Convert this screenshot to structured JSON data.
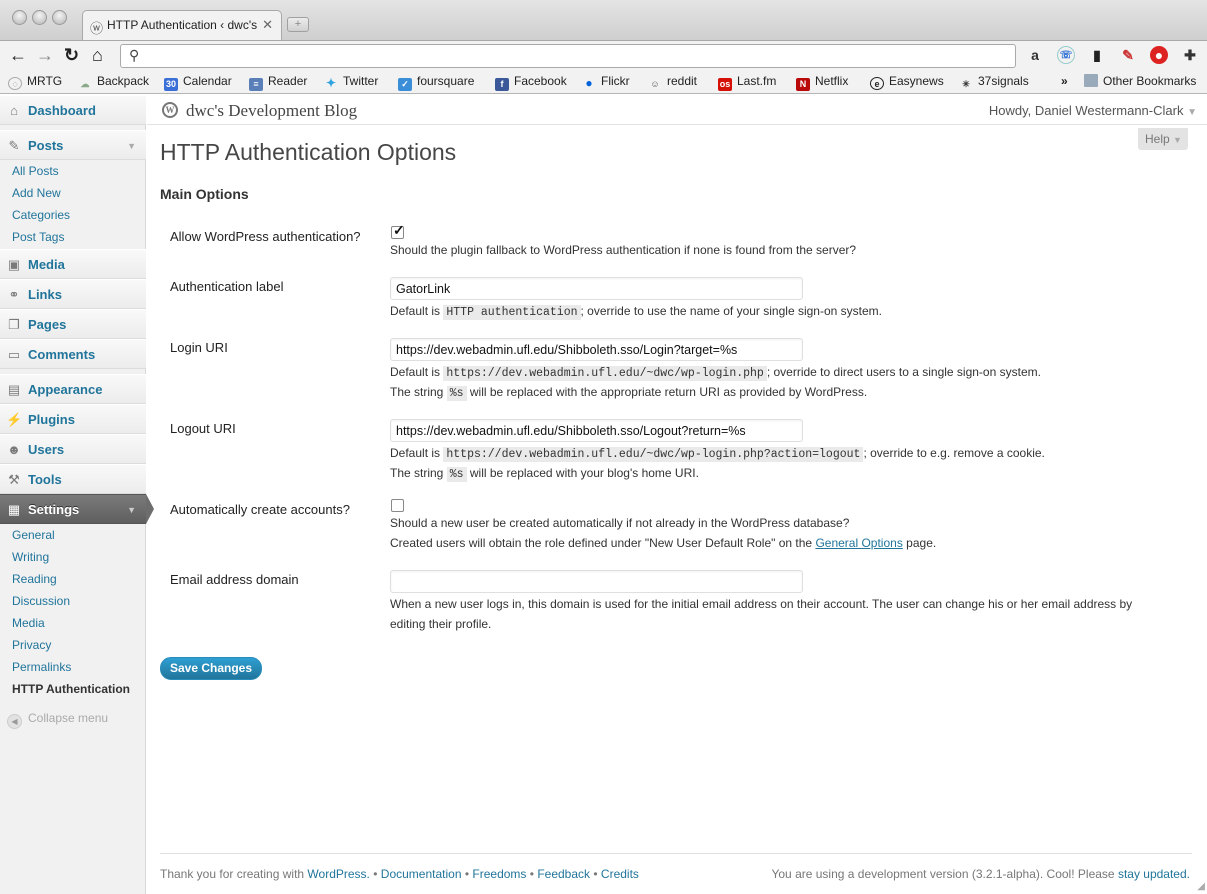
{
  "browser": {
    "tab_title": "HTTP Authentication ‹ dwc's",
    "url": "",
    "bookmarks": [
      "MRTG",
      "Backpack",
      "Calendar",
      "Reader",
      "Twitter",
      "foursquare",
      "Facebook",
      "Flickr",
      "reddit",
      "Last.fm",
      "Netflix",
      "Easynews",
      "37signals"
    ],
    "calendar_icon_text": "30",
    "overflow": "»",
    "other_bookmarks": "Other Bookmarks"
  },
  "sidebar": {
    "dashboard": "Dashboard",
    "posts": "Posts",
    "posts_sub": [
      "All Posts",
      "Add New",
      "Categories",
      "Post Tags"
    ],
    "media": "Media",
    "links": "Links",
    "pages": "Pages",
    "comments": "Comments",
    "appearance": "Appearance",
    "plugins": "Plugins",
    "users": "Users",
    "tools": "Tools",
    "settings": "Settings",
    "settings_sub": [
      "General",
      "Writing",
      "Reading",
      "Discussion",
      "Media",
      "Privacy",
      "Permalinks",
      "HTTP Authentication"
    ],
    "collapse": "Collapse menu"
  },
  "header": {
    "site_title": "dwc's Development Blog",
    "howdy": "Howdy, Daniel Westermann-Clark",
    "help": "Help"
  },
  "main": {
    "page_title": "HTTP Authentication Options",
    "section_title": "Main Options",
    "allow_wp": {
      "label": "Allow WordPress authentication?",
      "checked": true,
      "desc": "Should the plugin fallback to WordPress authentication if none is found from the server?"
    },
    "auth_label": {
      "label": "Authentication label",
      "value": "GatorLink",
      "desc_pre": "Default is",
      "desc_code": "HTTP authentication",
      "desc_post": "; override to use the name of your single sign-on system."
    },
    "login_uri": {
      "label": "Login URI",
      "value": "https://dev.webadmin.ufl.edu/Shibboleth.sso/Login?target=%s",
      "desc_pre": "Default is",
      "desc_code": "https://dev.webadmin.ufl.edu/~dwc/wp-login.php",
      "desc_post": "; override to direct users to a single sign-on system.",
      "desc2_pre": "The string",
      "desc2_code": "%s",
      "desc2_post": "will be replaced with the appropriate return URI as provided by WordPress."
    },
    "logout_uri": {
      "label": "Logout URI",
      "value": "https://dev.webadmin.ufl.edu/Shibboleth.sso/Logout?return=%s",
      "desc_pre": "Default is",
      "desc_code": "https://dev.webadmin.ufl.edu/~dwc/wp-login.php?action=logout",
      "desc_post": "; override to e.g. remove a cookie.",
      "desc2_pre": "The string",
      "desc2_code": "%s",
      "desc2_post": "will be replaced with your blog's home URI."
    },
    "auto_create": {
      "label": "Automatically create accounts?",
      "checked": false,
      "desc": "Should a new user be created automatically if not already in the WordPress database?",
      "desc2_pre": "Created users will obtain the role defined under \"New User Default Role\" on the",
      "desc2_link": "General Options",
      "desc2_post": "page."
    },
    "email_domain": {
      "label": "Email address domain",
      "value": "",
      "desc": "When a new user logs in, this domain is used for the initial email address on their account. The user can change his or her email address by",
      "desc2": "editing their profile."
    },
    "save_label": "Save Changes"
  },
  "footer": {
    "thanks": "Thank you for creating with",
    "wordpress": "WordPress.",
    "sep": "•",
    "links": [
      "Documentation",
      "Freedoms",
      "Feedback",
      "Credits"
    ],
    "version_text": "You are using a development version (3.2.1-alpha). Cool! Please",
    "stay_updated": "stay updated."
  }
}
